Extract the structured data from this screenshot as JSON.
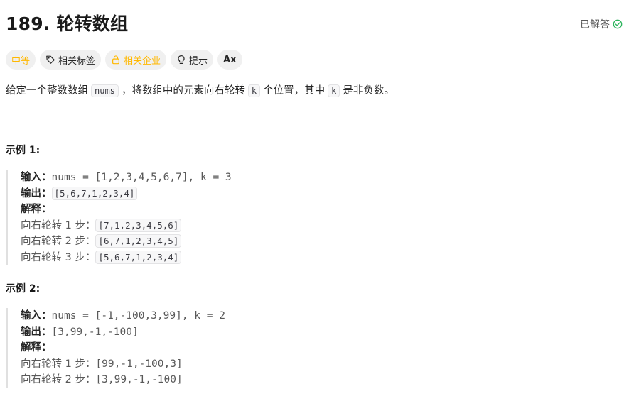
{
  "problem": {
    "title": "189. 轮转数组",
    "status": "已解答"
  },
  "tags": {
    "difficulty": "中等",
    "related_tags": "相关标签",
    "related_companies": "相关企业",
    "hint": "提示",
    "font_size": "Ax"
  },
  "description": {
    "part1": "给定一个整数数组",
    "code_nums": "nums",
    "part2": "，将数组中的元素向右轮转",
    "code_k1": "k",
    "part3": "个位置，其中",
    "code_k2": "k",
    "part4": "是非负数。"
  },
  "examples": [
    {
      "title": "示例 1:",
      "input_label": "输入：",
      "input_value": "nums = [1,2,3,4,5,6,7], k = 3",
      "output_label": "输出：",
      "output_value": "[5,6,7,1,2,3,4]",
      "explain_label": "解释：",
      "steps": [
        {
          "label": "向右轮转 1 步：",
          "value": "[7,1,2,3,4,5,6]"
        },
        {
          "label": "向右轮转 2 步：",
          "value": "[6,7,1,2,3,4,5]"
        },
        {
          "label": "向右轮转 3 步：",
          "value": "[5,6,7,1,2,3,4]"
        }
      ]
    },
    {
      "title": "示例 2:",
      "input_label": "输入：",
      "input_value": "nums = [-1,-100,3,99], k = 2",
      "output_label": "输出：",
      "output_value": "[3,99,-1,-100]",
      "explain_label": "解释：",
      "steps": [
        {
          "label": "向右轮转 1 步：",
          "value": "[99,-1,-100,3]"
        },
        {
          "label": "向右轮转 2 步：",
          "value": "[3,99,-1,-100]"
        }
      ]
    }
  ],
  "colors": {
    "difficulty_medium": "#ffb800",
    "solved_check": "#2db55d",
    "tag_bg": "#f0f0f0"
  },
  "icons": {
    "solved": "check-circle-icon",
    "related_tags": "tag-icon",
    "related_companies": "lock-icon",
    "hint": "lightbulb-icon",
    "font_size": "font-size-icon"
  }
}
